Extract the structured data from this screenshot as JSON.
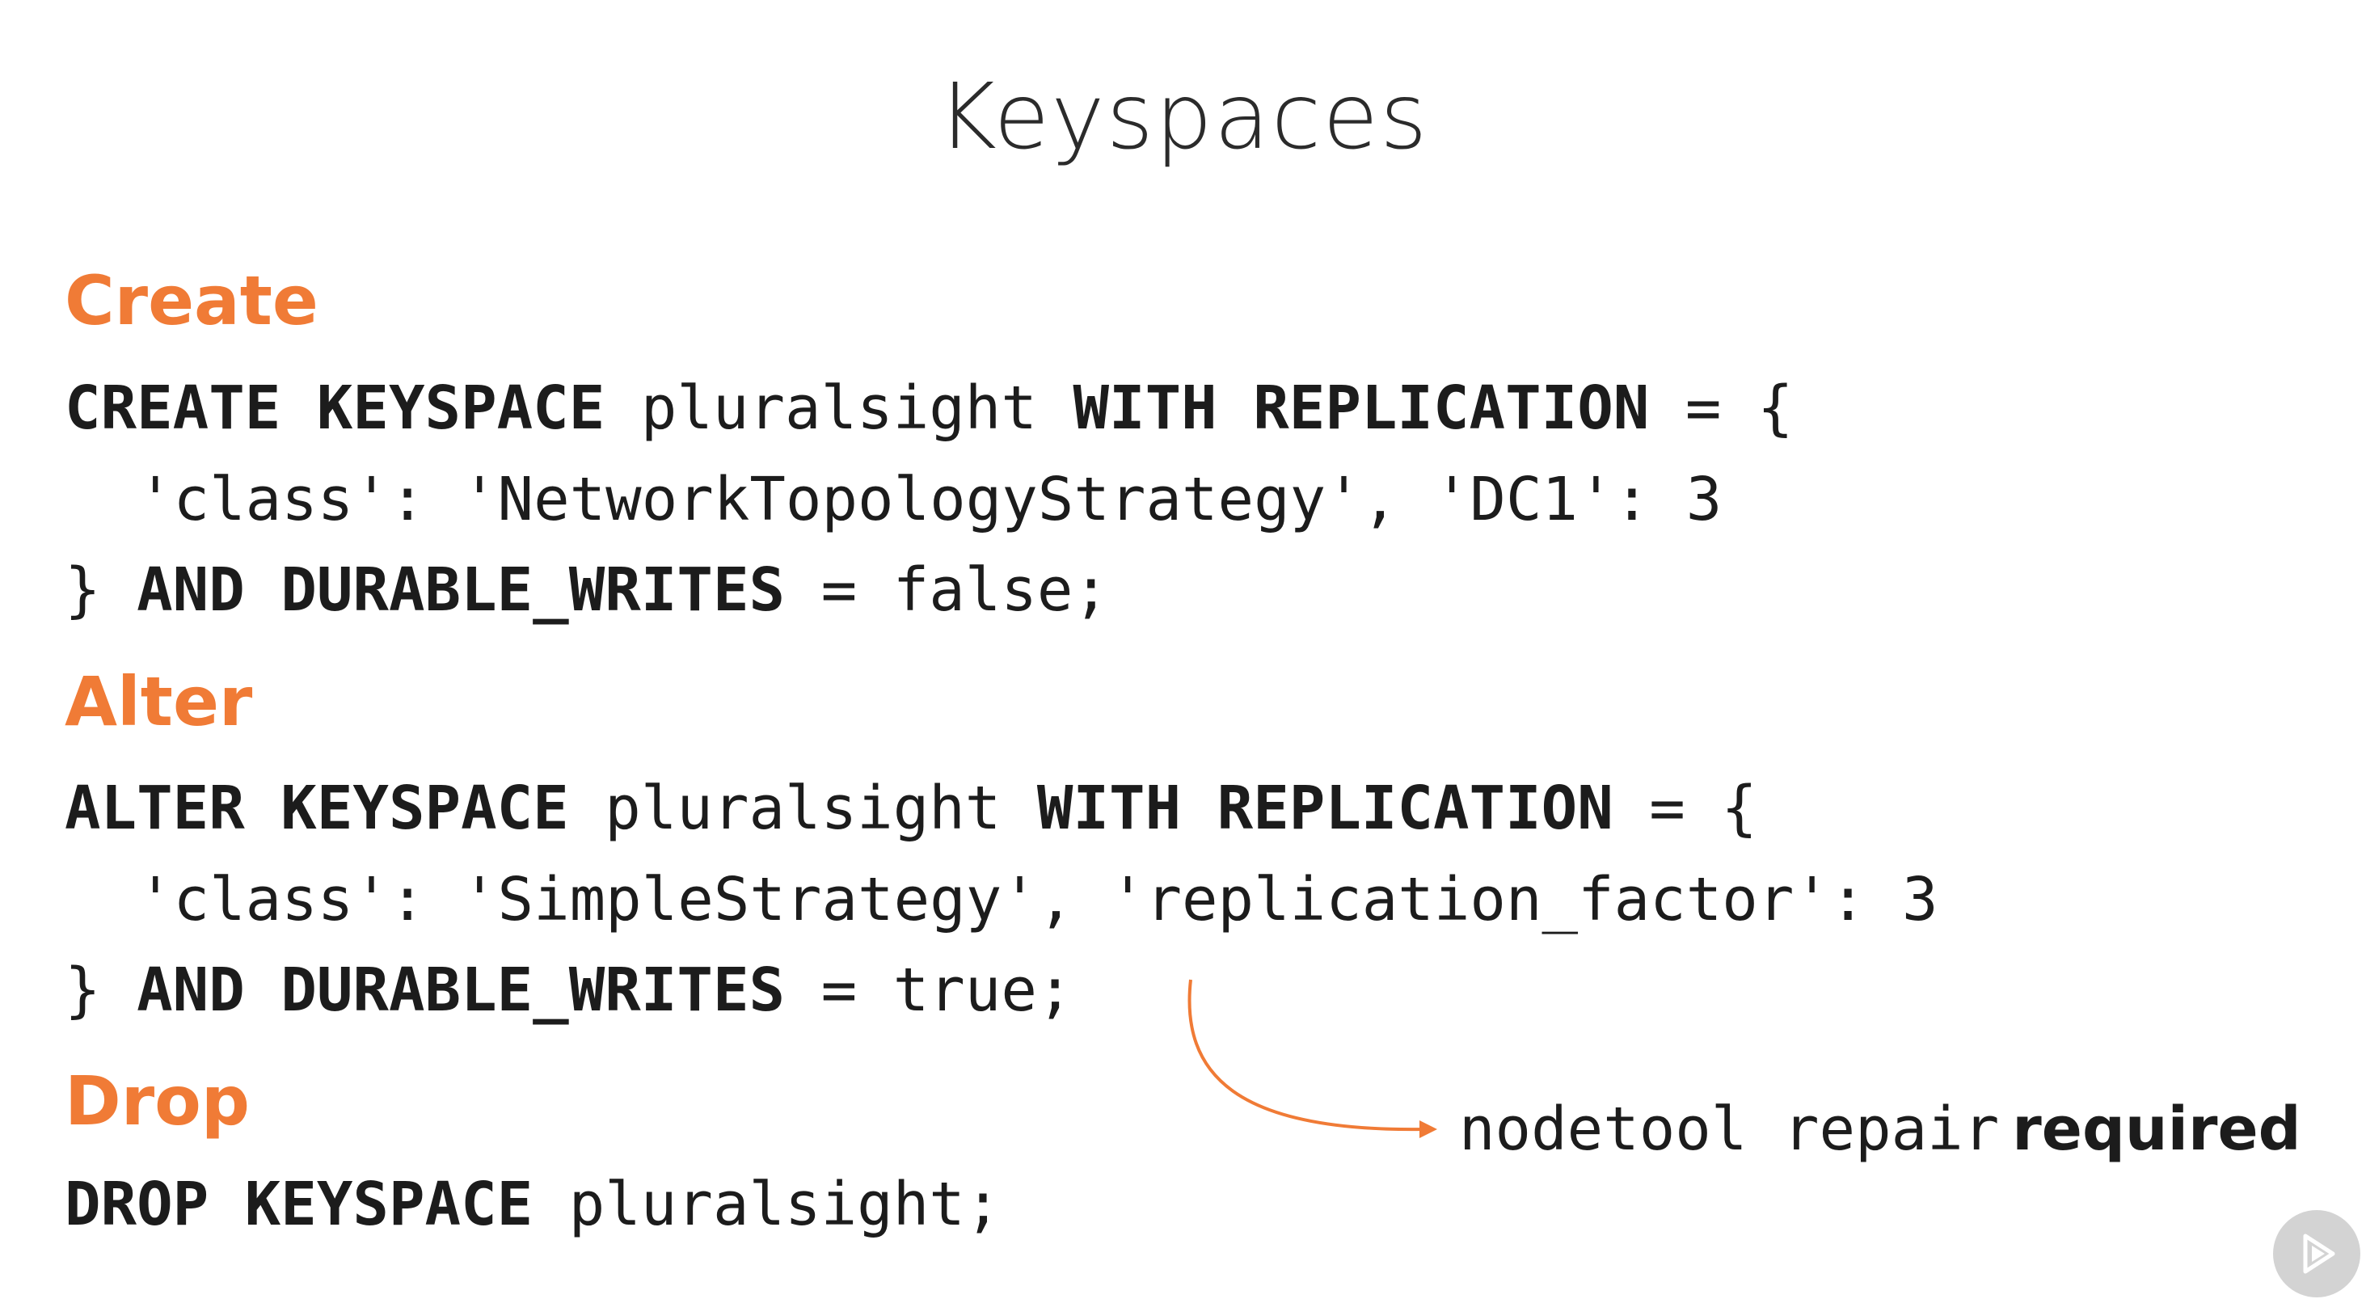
{
  "slide": {
    "title": "Keyspaces"
  },
  "sections": {
    "create": {
      "heading": "Create",
      "line1": {
        "kw1": "CREATE KEYSPACE",
        "name": " pluralsight ",
        "kw2": "WITH REPLICATION",
        "rest": " = {"
      },
      "line2": "'class': 'NetworkTopologyStrategy', 'DC1': 3",
      "line3": {
        "brace": "} ",
        "kw": "AND DURABLE_WRITES",
        "rest": " = false;"
      }
    },
    "alter": {
      "heading": "Alter",
      "line1": {
        "kw1": "ALTER KEYSPACE",
        "name": " pluralsight ",
        "kw2": "WITH REPLICATION",
        "rest": " = {"
      },
      "line2": "'class': 'SimpleStrategy', 'replication_factor': 3",
      "line3": {
        "brace": "} ",
        "kw": "AND DURABLE_WRITES",
        "rest": " = true;"
      }
    },
    "drop": {
      "heading": "Drop",
      "line1": {
        "kw": "DROP KEYSPACE",
        "rest": " pluralsight;"
      }
    }
  },
  "note": {
    "command": "nodetool repair",
    "suffix": "required"
  },
  "colors": {
    "accent": "#f07b36",
    "text": "#1c1c1c"
  },
  "icons": {
    "play": "play-icon"
  }
}
